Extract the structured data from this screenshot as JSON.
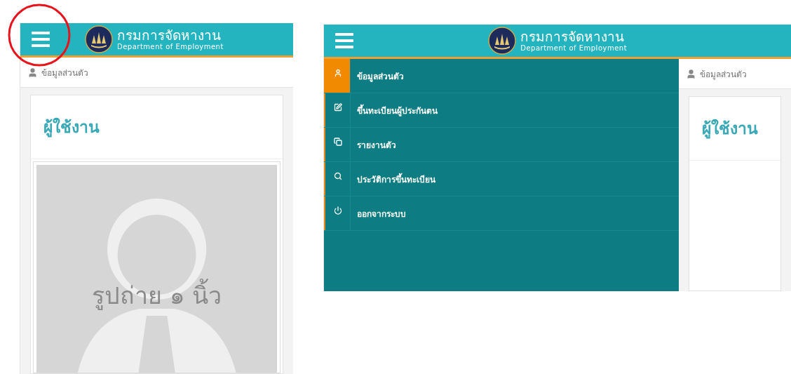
{
  "left_screen": {
    "header": {
      "title": "กรมการจัดหางาน",
      "subtitle": "Department of Employment"
    },
    "breadcrumb": "ข้อมูลส่วนตัว",
    "card_title": "ผู้ใช้งาน",
    "photo_caption": "รูปถ่าย ๑ นิ้ว"
  },
  "right_screen": {
    "header": {
      "title": "กรมการจัดหางาน",
      "subtitle": "Department of Employment"
    },
    "menu": [
      {
        "label": "ข้อมูลส่วนตัว",
        "selected": true
      },
      {
        "label": "ขึ้นทะเบียนผู้ประกันตน",
        "selected": false
      },
      {
        "label": "รายงานตัว",
        "selected": false
      },
      {
        "label": "ประวัติการขึ้นทะเบียน",
        "selected": false
      },
      {
        "label": "ออกจากระบบ",
        "selected": false
      }
    ],
    "breadcrumb": "ข้อมูลส่วนตัว",
    "card_title": "ผู้ใช้งาน"
  }
}
